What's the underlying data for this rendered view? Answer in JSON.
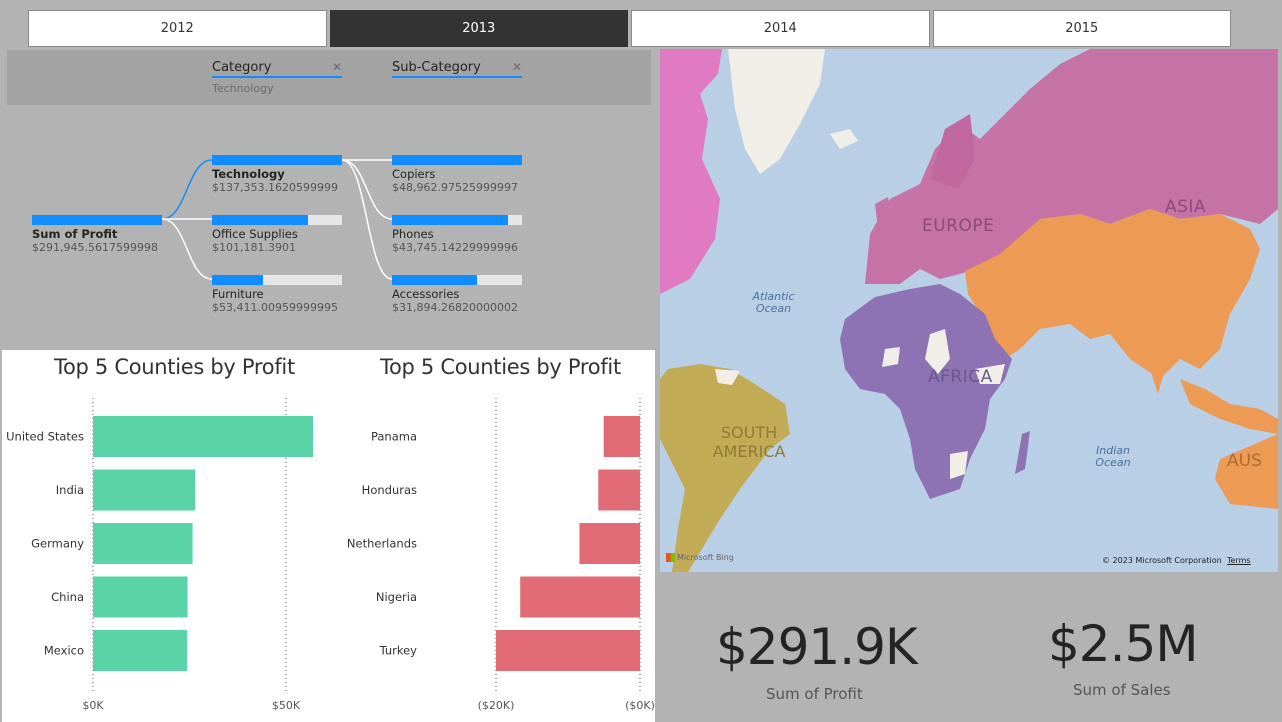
{
  "years": [
    {
      "label": "2012",
      "active": false
    },
    {
      "label": "2013",
      "active": true
    },
    {
      "label": "2014",
      "active": false
    },
    {
      "label": "2015",
      "active": false
    }
  ],
  "decomposition": {
    "filters": [
      {
        "title": "Category",
        "value": "Technology"
      },
      {
        "title": "Sub-Category",
        "value": ""
      }
    ],
    "root": {
      "label": "Sum of Profit",
      "value": "$291,945.5617599998",
      "fill": 1.0
    },
    "categories": [
      {
        "label": "Technology",
        "value": "$137,353.1620599999",
        "fill": 1.0,
        "selected": true
      },
      {
        "label": "Office Supplies",
        "value": "$101,181.3901",
        "fill": 0.74
      },
      {
        "label": "Furniture",
        "value": "$53,411.00959999995",
        "fill": 0.39
      }
    ],
    "subcategories": [
      {
        "label": "Copiers",
        "value": "$48,962.97525999997",
        "fill": 1.0
      },
      {
        "label": "Phones",
        "value": "$43,745.14229999996",
        "fill": 0.89
      },
      {
        "label": "Accessories",
        "value": "$31,894.26820000002",
        "fill": 0.65
      }
    ]
  },
  "chart_data": [
    {
      "type": "bar",
      "title": "Top 5 Counties by Profit",
      "categories": [
        "United States",
        "India",
        "Germany",
        "China",
        "Mexico"
      ],
      "values": [
        57000,
        26500,
        25800,
        24500,
        24400
      ],
      "xlim": [
        0,
        57000
      ],
      "ticks": [
        {
          "value": 0,
          "label": "$0K"
        },
        {
          "value": 50000,
          "label": "$50K"
        }
      ],
      "color": "#5ad3a7"
    },
    {
      "type": "bar",
      "title": "Top 5 Counties by Profit",
      "categories": [
        "Panama",
        "Honduras",
        "Netherlands",
        "Nigeria",
        "Turkey"
      ],
      "values": [
        -5400,
        -6200,
        -9000,
        -17800,
        -21400
      ],
      "xlim": [
        -21400,
        0
      ],
      "ticks": [
        {
          "value": -21400,
          "label": "($20K)"
        },
        {
          "value": 0,
          "label": "($0K)"
        }
      ],
      "color": "#e06b74"
    }
  ],
  "map": {
    "labels": {
      "europe": "EUROPE",
      "asia": "ASIA",
      "africa": "AFRICA",
      "south_america": "SOUTH AMERICA",
      "australia": "AUS",
      "atlantic": "Atlantic Ocean",
      "indian": "Indian Ocean"
    },
    "attribution": "© 2023 Microsoft Corporation",
    "terms": "Terms",
    "bing": "Microsoft Bing",
    "colors": {
      "ocean": "#b9cfe6",
      "europe_asia": "#c572a6",
      "north_america": "#e07bc3",
      "middle_east": "#ec9a54",
      "africa": "#8d73b4",
      "south_america": "#c2ab55",
      "land": "#f1eee8"
    }
  },
  "cards": [
    {
      "value": "$291.9K",
      "label": "Sum of Profit"
    },
    {
      "value": "$2.5M",
      "label": "Sum of Sales"
    }
  ]
}
